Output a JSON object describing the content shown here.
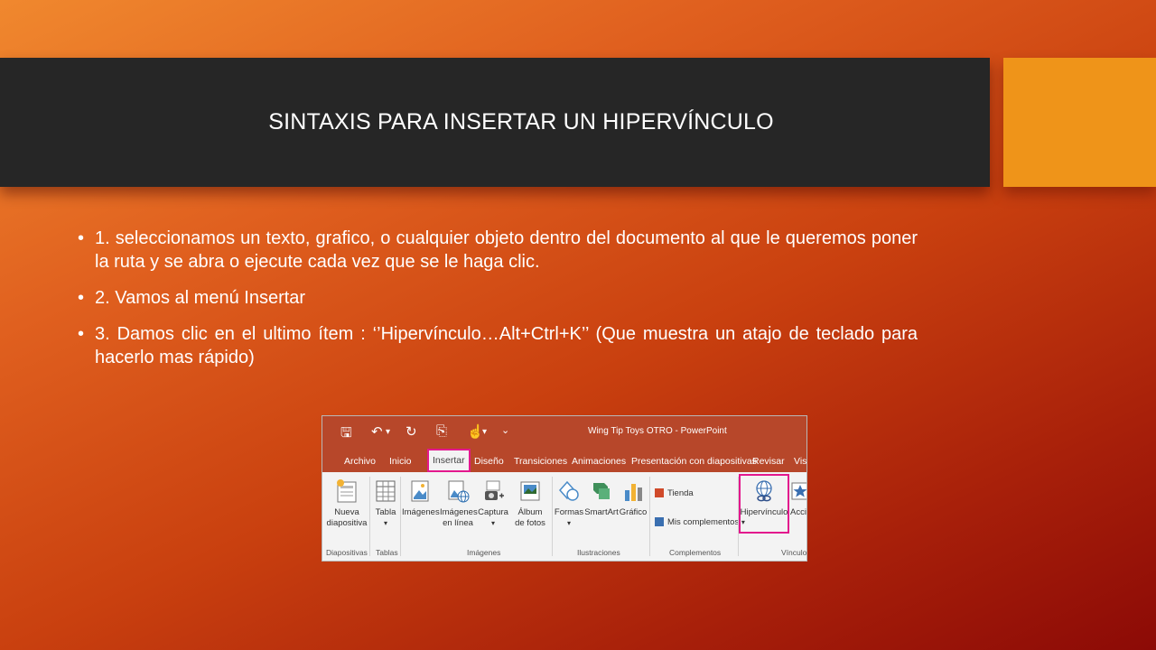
{
  "slide": {
    "title": "SINTAXIS PARA INSERTAR UN HIPERVÍNCULO",
    "bullet_char": "•",
    "bullets": [
      "1. seleccionamos un texto, grafico, o cualquier objeto dentro del documento al que le queremos poner la ruta y se abra o ejecute cada vez que se le haga clic.",
      "2. Vamos al menú Insertar",
      "3. Damos clic en el ultimo ítem : ‘’Hipervínculo…Alt+Ctrl+K’’ (Que muestra un atajo de teclado para hacerlo mas rápido)"
    ],
    "colors": {
      "title_bar": "#262626",
      "accent": "#ef9419",
      "text": "#ffffff"
    }
  },
  "ribbon": {
    "app_title": "Wing Tip Toys OTRO - PowerPoint",
    "qat": {
      "save": "🖫",
      "undo": "↶",
      "dropdown": "▾",
      "redo": "↻",
      "present": "⎘",
      "touch": "☝",
      "more": "⌄"
    },
    "tabs": [
      "Archivo",
      "Inicio",
      "Insertar",
      "Diseño",
      "Transiciones",
      "Animaciones",
      "Presentación con diapositivas",
      "Revisar",
      "Vis"
    ],
    "active_tab": "Insertar",
    "buttons": {
      "nueva_diapositiva": "Nueva\ndiapositiva",
      "tabla": "Tabla",
      "imagenes": "Imágenes",
      "imagenes_linea": "Imágenes\nen línea",
      "captura": "Captura",
      "album": "Álbum\nde fotos",
      "formas": "Formas",
      "smartart": "SmartArt",
      "grafico": "Gráfico",
      "tienda": "Tienda",
      "mis_complementos": "Mis complementos",
      "hipervinculo": "Hipervínculo",
      "accion": "Acció"
    },
    "groups": {
      "diapositivas": "Diapositivas",
      "tablas": "Tablas",
      "imagenes": "Imágenes",
      "ilustraciones": "Ilustraciones",
      "complementos": "Complementos",
      "vinculos": "Vínculos"
    },
    "highlight_color": "#e3188d",
    "ribbon_color": "#b7472a"
  }
}
